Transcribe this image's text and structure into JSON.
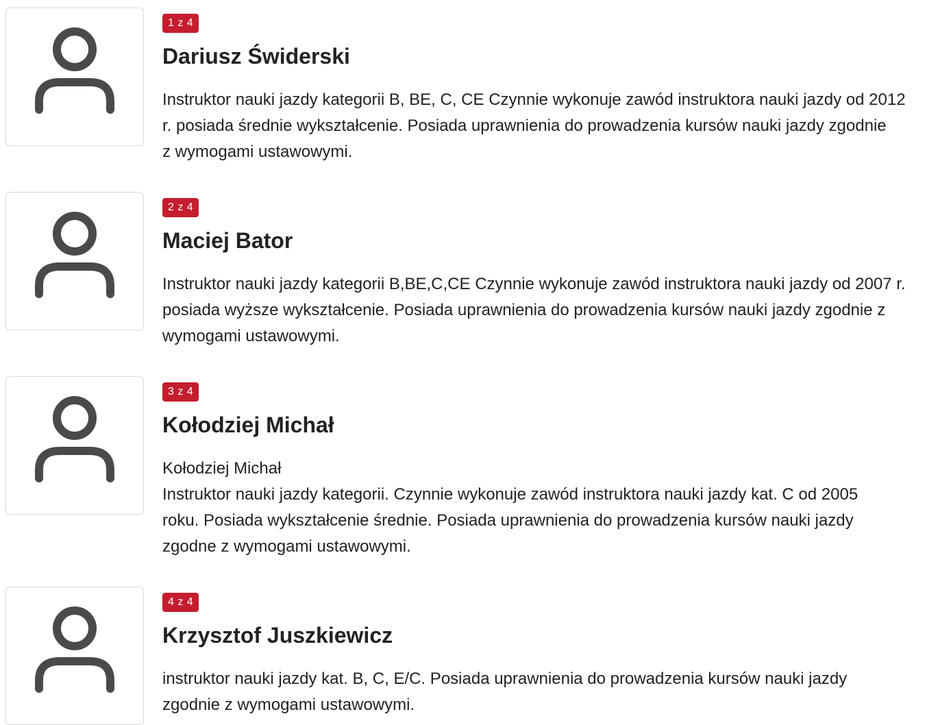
{
  "colors": {
    "badge_bg": "#c41e2e",
    "badge_text": "#ffffff",
    "avatar_icon": "#4a4a4a",
    "border": "#d9d9d9"
  },
  "instructors": [
    {
      "badge": "1 z 4",
      "name": "Dariusz Świderski",
      "avatar_icon": "user-icon",
      "description": [
        "Instruktor nauki jazdy kategorii B, BE, C, CE Czynnie wykonuje zawód instruktora nauki jazdy od 2012",
        "r. posiada średnie wykształcenie. Posiada uprawnienia do prowadzenia kursów nauki jazdy zgodnie",
        "z wymogami ustawowymi."
      ]
    },
    {
      "badge": "2 z 4",
      "name": "Maciej Bator",
      "avatar_icon": "user-icon",
      "description": [
        "Instruktor nauki jazdy kategorii B,BE,C,CE Czynnie wykonuje zawód instruktora nauki jazdy od 2007 r.",
        "posiada wyższe wykształcenie. Posiada uprawnienia do prowadzenia kursów nauki jazdy zgodnie z",
        "wymogami ustawowymi."
      ]
    },
    {
      "badge": "3 z 4",
      "name": "Kołodziej Michał",
      "avatar_icon": "user-icon",
      "description": [
        "Kołodziej Michał",
        "Instruktor nauki jazdy kategorii. Czynnie wykonuje zawód instruktora nauki jazdy kat. C od 2005",
        "roku. Posiada wykształcenie średnie. Posiada uprawnienia do prowadzenia kursów nauki jazdy",
        "zgodne z wymogami ustawowymi."
      ]
    },
    {
      "badge": "4 z 4",
      "name": "Krzysztof Juszkiewicz",
      "avatar_icon": "user-icon",
      "description": [
        "instruktor nauki jazdy kat. B, C, E/C. Posiada uprawnienia do prowadzenia kursów nauki jazdy",
        "zgodnie z wymogami ustawowymi."
      ]
    }
  ]
}
